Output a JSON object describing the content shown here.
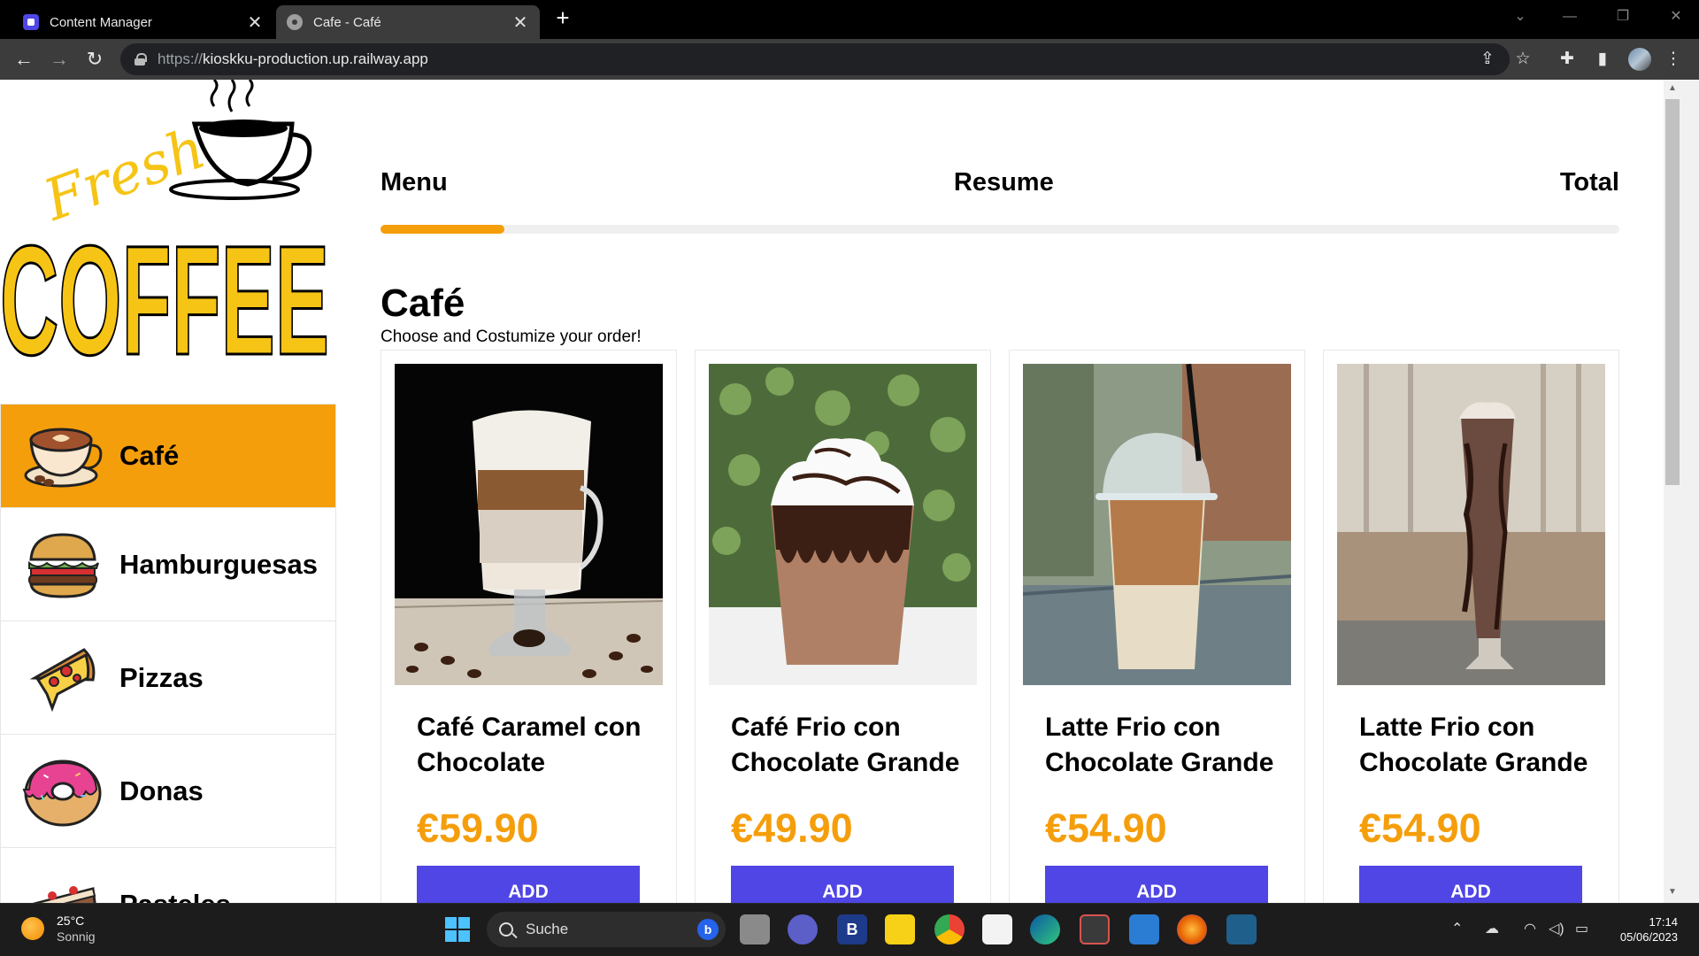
{
  "browser": {
    "tabs": [
      {
        "title": "Content Manager",
        "close": "✕"
      },
      {
        "title": "Cafe - Café",
        "close": "✕"
      }
    ],
    "new_tab": "+",
    "url_scheme": "https://",
    "url_host": "kioskku-production.up.railway.app"
  },
  "logo": {
    "script_word": "Fresh",
    "word": "COFFEE"
  },
  "sidebar": {
    "items": [
      {
        "label": "Café",
        "icon": "coffee-cup-icon",
        "active": true
      },
      {
        "label": "Hamburguesas",
        "icon": "burger-icon",
        "active": false
      },
      {
        "label": "Pizzas",
        "icon": "pizza-icon",
        "active": false
      },
      {
        "label": "Donas",
        "icon": "donut-icon",
        "active": false
      },
      {
        "label": "Pasteles",
        "icon": "cake-icon",
        "active": false
      }
    ]
  },
  "steps": {
    "labels": [
      "Menu",
      "Resume",
      "Total"
    ],
    "progress": 0.1
  },
  "category": {
    "title": "Café",
    "subtitle": "Choose and Costumize your order!"
  },
  "products": [
    {
      "name": "Café Caramel con Chocolate",
      "price": "€59.90",
      "button": "ADD"
    },
    {
      "name": "Café Frio con Chocolate Grande",
      "price": "€49.90",
      "button": "ADD"
    },
    {
      "name": "Latte Frio con Chocolate Grande",
      "price": "€54.90",
      "button": "ADD"
    },
    {
      "name": "Latte Frio con Chocolate Grande",
      "price": "€54.90",
      "button": "ADD"
    }
  ],
  "taskbar": {
    "temperature": "25°C",
    "condition": "Sonnig",
    "search_label": "Suche",
    "time": "17:14",
    "date": "05/06/2023"
  },
  "colors": {
    "accent": "#f59e0b",
    "button": "#4f46e5",
    "logo_yellow": "#f6c415"
  }
}
